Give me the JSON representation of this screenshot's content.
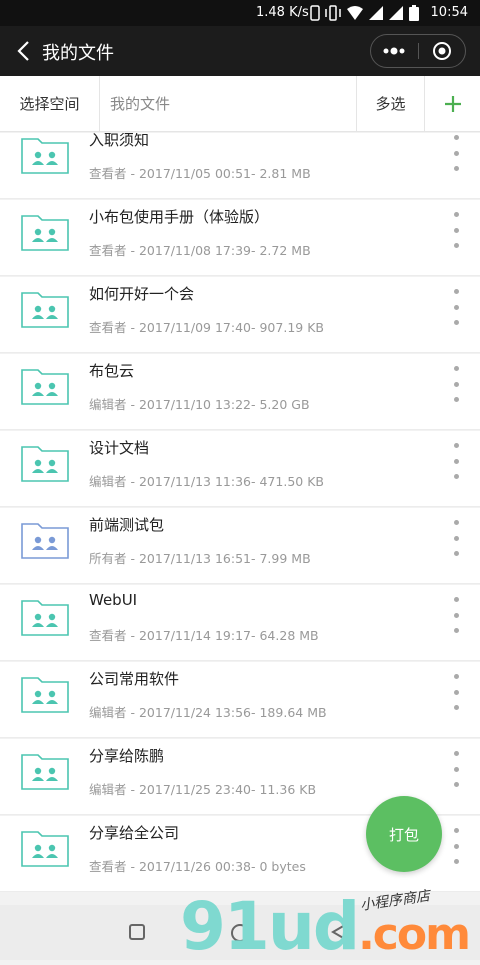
{
  "status": {
    "speed": "1.48 K/s",
    "time": "10:54"
  },
  "navbar": {
    "title": "我的文件",
    "back_icon": "back-arrow-icon",
    "more_icon": "more-dots-icon",
    "close_icon": "target-circle-icon"
  },
  "toolbar": {
    "space_label": "选择空间",
    "breadcrumb": "我的文件",
    "multi_label": "多选",
    "add_icon": "plus-icon",
    "accent": "#4caf50"
  },
  "files": [
    {
      "name": "入职须知",
      "meta": "查看者 - 2017/11/05 00:51- 2.81 MB",
      "color": "#4bc5b0"
    },
    {
      "name": "小布包使用手册（体验版）",
      "meta": "查看者 - 2017/11/08 17:39- 2.72 MB",
      "color": "#4bc5b0"
    },
    {
      "name": "如何开好一个会",
      "meta": "查看者 - 2017/11/09 17:40- 907.19 KB",
      "color": "#4bc5b0"
    },
    {
      "name": "布包云",
      "meta": "编辑者 - 2017/11/10 13:22- 5.20 GB",
      "color": "#4bc5b0"
    },
    {
      "name": "设计文档",
      "meta": "编辑者 - 2017/11/13 11:36- 471.50 KB",
      "color": "#4bc5b0"
    },
    {
      "name": "前端测试包",
      "meta": "所有者 - 2017/11/13 16:51- 7.99 MB",
      "color": "#7a9ad6"
    },
    {
      "name": "WebUI",
      "meta": "查看者 - 2017/11/14 19:17- 64.28 MB",
      "color": "#4bc5b0"
    },
    {
      "name": "公司常用软件",
      "meta": "编辑者 - 2017/11/24 13:56- 189.64 MB",
      "color": "#4bc5b0"
    },
    {
      "name": "分享给陈鹏",
      "meta": "编辑者 - 2017/11/25 23:40- 11.36 KB",
      "color": "#4bc5b0"
    },
    {
      "name": "分享给全公司",
      "meta": "查看者 - 2017/11/26 00:38- 0 bytes",
      "color": "#4bc5b0"
    }
  ],
  "fab": {
    "label": "打包",
    "color": "#5cbf62"
  },
  "watermark": {
    "brand": "91ud",
    "suffix": ".com",
    "sub": "小程序商店"
  }
}
